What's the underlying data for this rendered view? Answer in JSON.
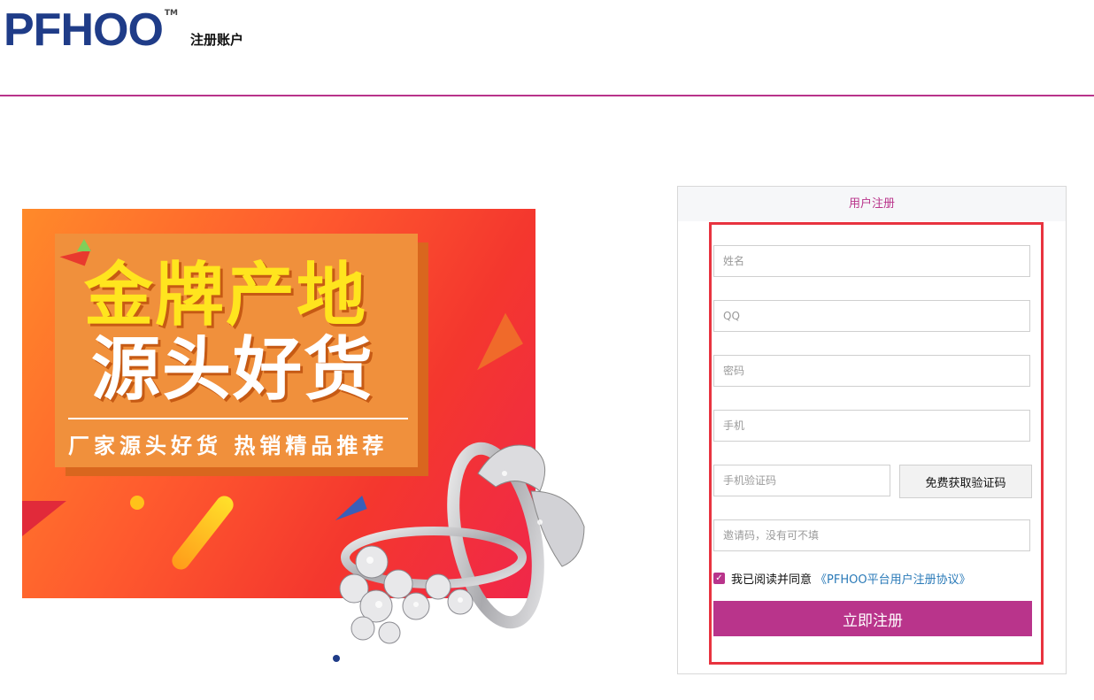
{
  "header": {
    "logo_text": "PFHOO",
    "logo_tm": "TM",
    "subtitle": "注册账户"
  },
  "banner": {
    "title_line1": "金牌产地",
    "title_line2": "源头好货",
    "tagline": "厂家源头好货 热销精品推荐"
  },
  "register": {
    "panel_title": "用户注册",
    "fields": {
      "name_placeholder": "姓名",
      "qq_placeholder": "QQ",
      "password_placeholder": "密码",
      "phone_placeholder": "手机",
      "sms_code_placeholder": "手机验证码",
      "invite_placeholder": "邀请码，没有可不填"
    },
    "sms_button_label": "免费获取验证码",
    "agree_text": "我已阅读并同意",
    "agree_link": "《PFHOO平台用户注册协议》",
    "agree_checked": true,
    "submit_label": "立即注册"
  },
  "colors": {
    "brand": "#b9348b",
    "logo_blue": "#1f3c88",
    "highlight_border": "#e8333f",
    "link": "#2a7ab8"
  },
  "icons": [
    "checkbox-checked-icon",
    "carousel-dot-icon"
  ]
}
